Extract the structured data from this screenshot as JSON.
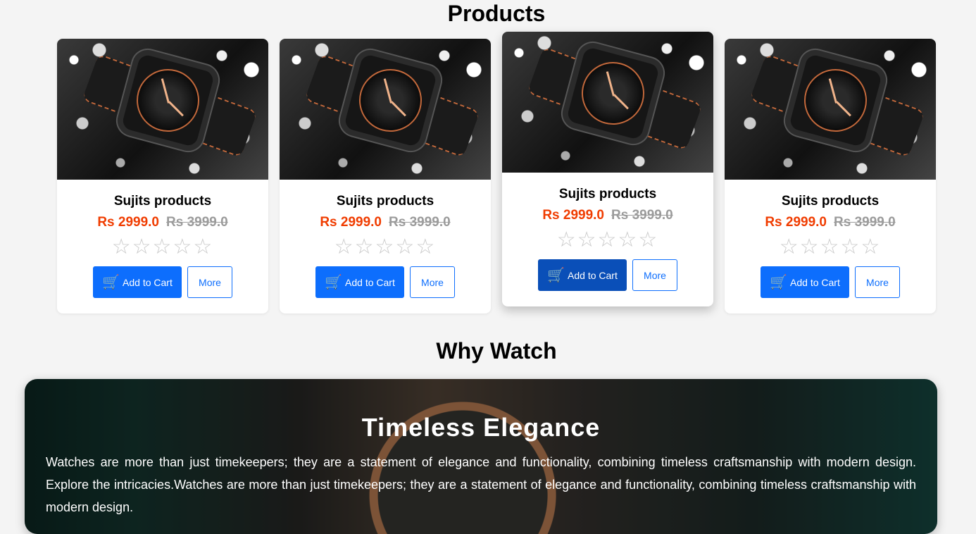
{
  "products_section": {
    "title": "Products"
  },
  "products": [
    {
      "name": "Sujits products",
      "price": "Rs 2999.0",
      "old_price": "Rs 3999.0",
      "rating": 0,
      "stars": "☆☆☆☆☆",
      "cart_label": "Add to Cart",
      "more_label": "More",
      "cart_icon": "cart-icon"
    },
    {
      "name": "Sujits products",
      "price": "Rs 2999.0",
      "old_price": "Rs 3999.0",
      "rating": 0,
      "stars": "☆☆☆☆☆",
      "cart_label": "Add to Cart",
      "more_label": "More",
      "cart_icon": "cart-icon"
    },
    {
      "name": "Sujits products",
      "price": "Rs 2999.0",
      "old_price": "Rs 3999.0",
      "rating": 0,
      "stars": "☆☆☆☆☆",
      "cart_label": "Add to Cart",
      "more_label": "More",
      "cart_icon": "cart-icon"
    },
    {
      "name": "Sujits products",
      "price": "Rs 2999.0",
      "old_price": "Rs 3999.0",
      "rating": 0,
      "stars": "☆☆☆☆☆",
      "cart_label": "Add to Cart",
      "more_label": "More",
      "cart_icon": "cart-icon"
    }
  ],
  "why_section": {
    "title": "Why Watch",
    "banner_heading": "Timeless Elegance",
    "banner_text": "Watches are more than just timekeepers; they are a statement of elegance and functionality, combining timeless craftsmanship with modern design. Explore the intricacies.Watches are more than just timekeepers; they are a statement of elegance and functionality, combining timeless craftsmanship with modern design."
  },
  "colors": {
    "accent": "#0d6efd",
    "price": "#f03c00",
    "old_price": "#8a8a8a",
    "background": "#f4f4f4"
  }
}
